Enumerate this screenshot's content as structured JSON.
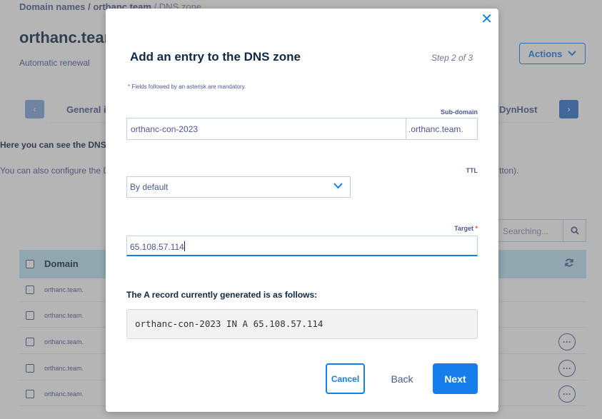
{
  "background": {
    "breadcrumb": {
      "part1": "Domain names / ",
      "part2": "orthanc.team",
      "part3": " / DNS zone"
    },
    "title": "orthanc.team",
    "subtitle": "Automatic renewal",
    "actions_label": "Actions",
    "tabs": {
      "general": "General information",
      "dynhost": "DynHost"
    },
    "info_bold": "Here you can see the DNS zone for your domain name.",
    "info_text": "You can also configure the DNS zone",
    "info_text_tail": "tton).",
    "search_placeholder": "Searching...",
    "table": {
      "domain_header": "Domain",
      "rows": [
        "orthanc.team.",
        "orthanc.team.",
        "orthanc.team.",
        "orthanc.team.",
        "orthanc.team."
      ]
    }
  },
  "modal": {
    "title": "Add an entry to the DNS zone",
    "step": "Step 2 of 3",
    "mandatory_note": "Fields followed by an asterisk are mandatory.",
    "subdomain_label": "Sub-domain",
    "subdomain_value": "orthanc-con-2023",
    "subdomain_suffix": ".orthanc.team.",
    "ttl_label": "TTL",
    "ttl_value": "By default",
    "target_label": "Target",
    "target_value": "65.108.57.114",
    "generated_label": "The A record currently generated is as follows:",
    "generated_record": "orthanc-con-2023 IN A 65.108.57.114",
    "cancel_label": "Cancel",
    "back_label": "Back",
    "next_label": "Next"
  },
  "colors": {
    "accent": "#157eea",
    "text": "#4d5693",
    "heading": "#122844",
    "table_header": "#bde3f2"
  },
  "icons": {
    "close": "close-icon",
    "chevron": "chevron-down-icon",
    "search": "search-icon",
    "refresh": "refresh-icon",
    "more": "more-icon"
  }
}
